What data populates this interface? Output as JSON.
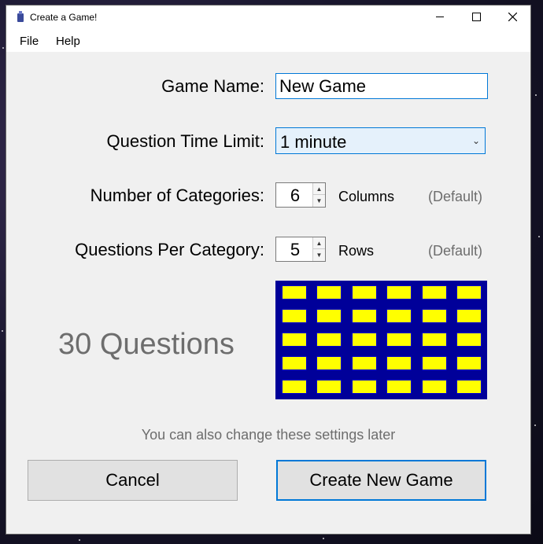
{
  "window": {
    "title": "Create a Game!",
    "controls": {
      "minimize": "—",
      "maximize": "☐",
      "close": "✕"
    }
  },
  "menu": {
    "file": "File",
    "help": "Help"
  },
  "form": {
    "game_name_label": "Game Name:",
    "game_name_value": "New Game",
    "time_limit_label": "Question Time Limit:",
    "time_limit_value": "1 minute",
    "categories_label": "Number of Categories:",
    "categories_value": "6",
    "categories_unit": "Columns",
    "categories_default": "(Default)",
    "questions_label": "Questions Per Category:",
    "questions_value": "5",
    "questions_unit": "Rows",
    "questions_default": "(Default)"
  },
  "summary": {
    "question_count": "30 Questions"
  },
  "grid": {
    "columns": 6,
    "rows": 5,
    "board_color": "#000099",
    "cell_color": "#ffff00"
  },
  "hint": "You can also change these settings later",
  "buttons": {
    "cancel": "Cancel",
    "create": "Create New Game"
  },
  "colors": {
    "accent": "#0078d7"
  }
}
